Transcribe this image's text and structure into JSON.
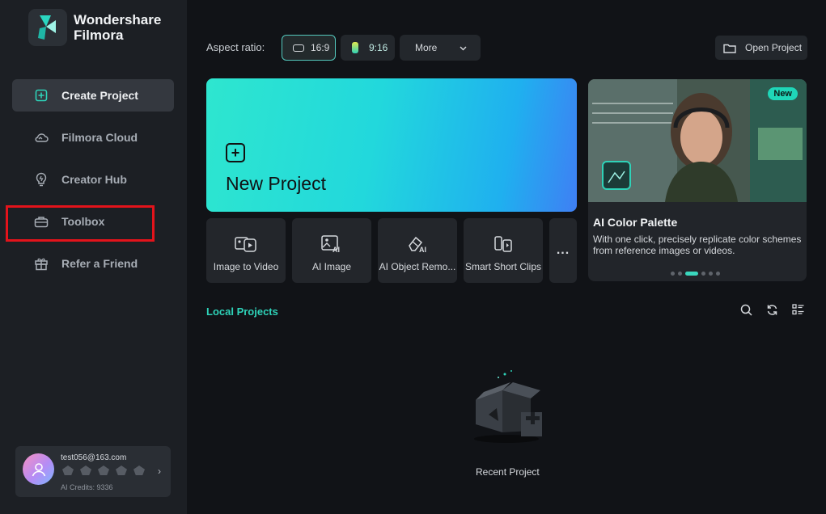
{
  "brand": {
    "line1": "Wondershare",
    "line2": "Filmora"
  },
  "sidebar": {
    "items": [
      {
        "label": "Create Project",
        "icon": "plus-square-icon"
      },
      {
        "label": "Filmora Cloud",
        "icon": "cloud-icon"
      },
      {
        "label": "Creator Hub",
        "icon": "lightbulb-icon"
      },
      {
        "label": "Toolbox",
        "icon": "toolbox-icon"
      },
      {
        "label": "Refer a Friend",
        "icon": "gift-icon"
      }
    ],
    "active_index": 0,
    "highlighted_index": 3
  },
  "user": {
    "email": "test056@163.com",
    "credits": "AI Credits: 9336"
  },
  "aspect": {
    "label": "Aspect ratio:",
    "options": [
      {
        "label": "16:9",
        "selected": true
      },
      {
        "label": "9:16",
        "selected": false
      }
    ],
    "more_label": "More"
  },
  "open_project": {
    "label": "Open Project"
  },
  "new_project": {
    "label": "New Project"
  },
  "tools": [
    {
      "label": "Image to Video",
      "icon": "image-to-video-icon"
    },
    {
      "label": "AI Image",
      "icon": "ai-image-icon"
    },
    {
      "label": "AI Object Remo...",
      "icon": "ai-eraser-icon"
    },
    {
      "label": "Smart Short Clips",
      "icon": "smart-clips-icon"
    }
  ],
  "tools_more": "...",
  "promo": {
    "badge": "New",
    "title": "AI Color Palette",
    "description": "With one click, precisely replicate color schemes from reference images or videos.",
    "dots": 6,
    "active_dot": 2
  },
  "local_projects": {
    "title": "Local Projects"
  },
  "empty_state": {
    "label": "Recent Project"
  },
  "colors": {
    "accent": "#2ed3b9",
    "highlight_red": "#e3131b"
  }
}
